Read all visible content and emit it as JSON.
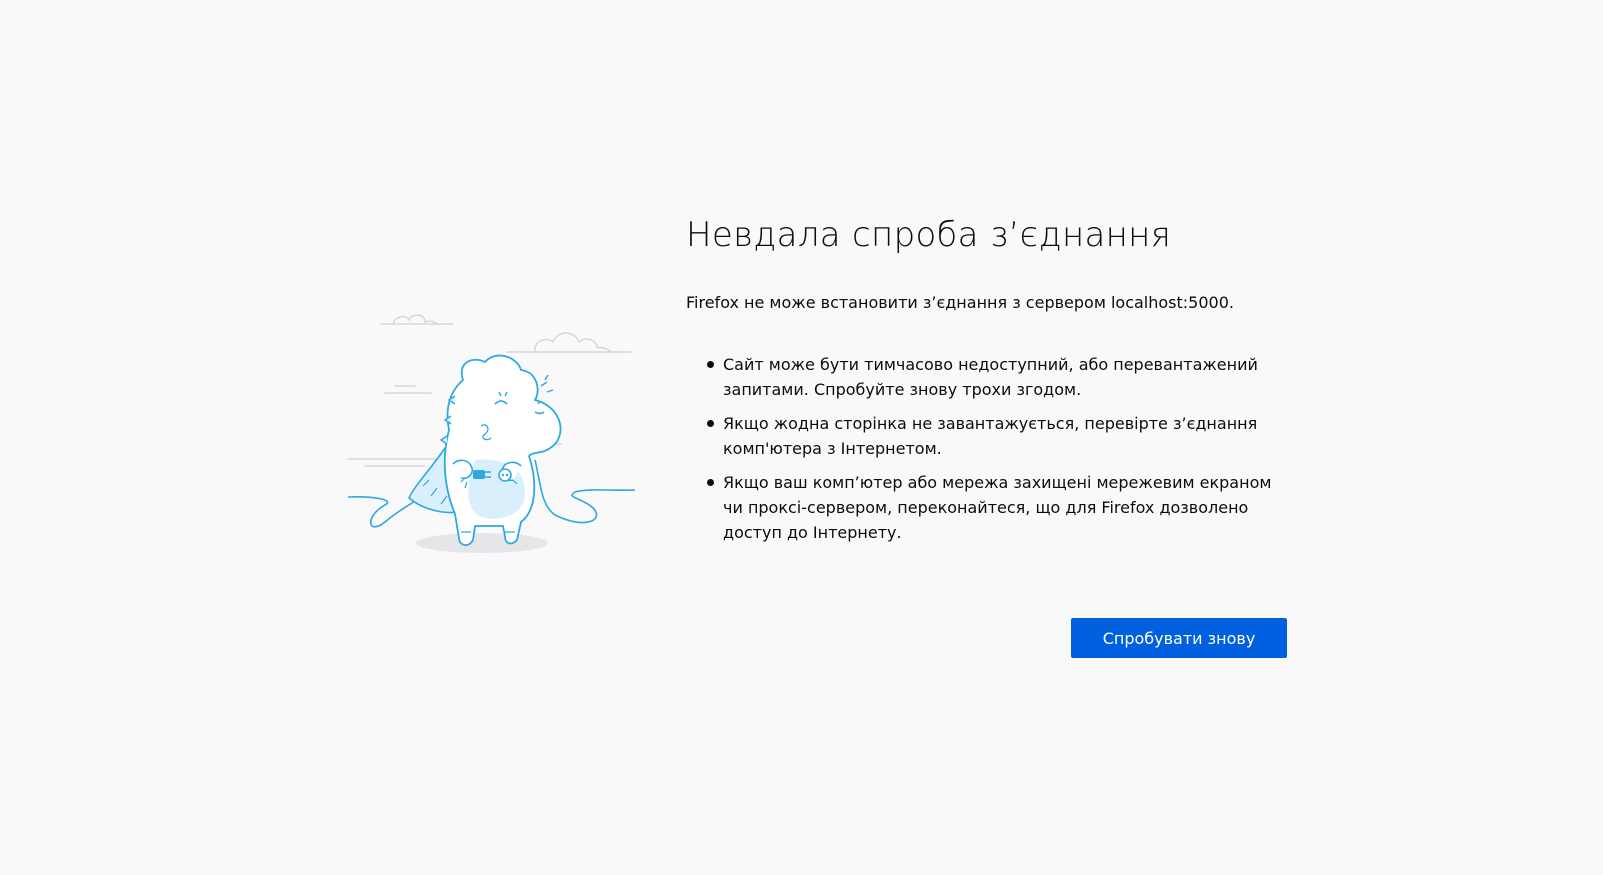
{
  "error": {
    "title": "Невдала спроба з’єднання",
    "description": "Firefox не може встановити з’єднання з сервером localhost:5000.",
    "tips": [
      "Сайт може бути тимчасово недоступний, або перевантажений запитами. Спробуйте знову трохи згодом.",
      "Якщо жодна сторінка не завантажується, перевірте з’єднання комп'ютера з Інтернетом.",
      "Якщо ваш комп’ютер або мережа захищені мережевим екраном чи проксі-сервером, переконайтеся, що для Firefox дозволено доступ до Інтернету."
    ],
    "retry_label": "Спробувати знову"
  },
  "colors": {
    "background": "#f9f9fa",
    "primary_button": "#0060df",
    "illustration_stroke": "#2fa8e0",
    "illustration_fill": "#d9f0fc"
  },
  "icons": {
    "illustration": "disconnected-dinosaur-illustration"
  }
}
